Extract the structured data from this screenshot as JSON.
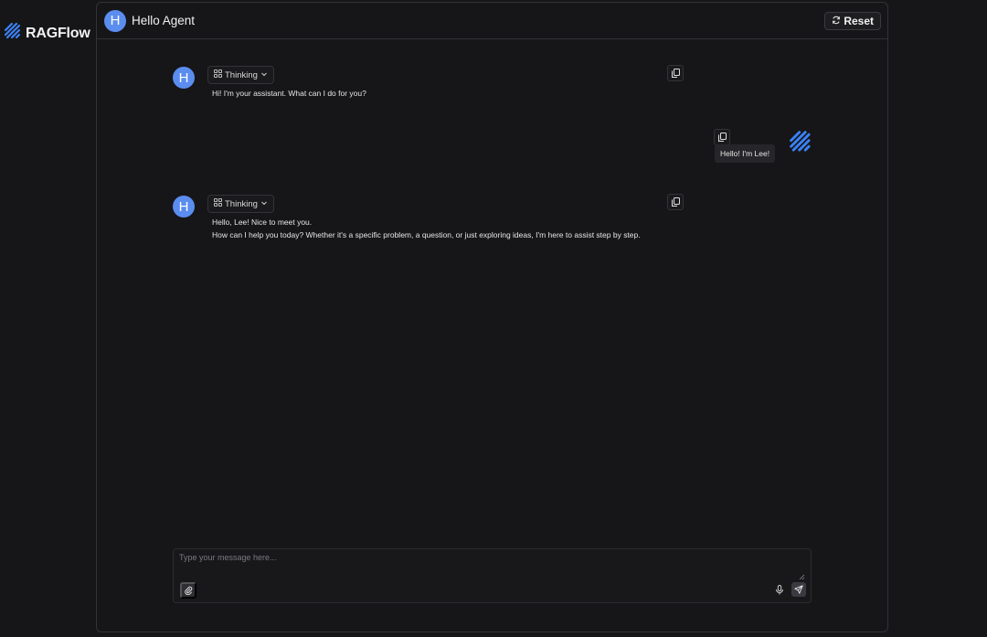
{
  "brand": {
    "name": "RAGFlow",
    "logo_icon": "ragflow-logo-icon"
  },
  "header": {
    "avatar_letter": "H",
    "title": "Hello Agent",
    "reset_label": "Reset",
    "reset_icon": "refresh-icon"
  },
  "messages": [
    {
      "role": "assistant",
      "avatar_letter": "H",
      "thinking_label": "Thinking",
      "lines": [
        "Hi! I'm your assistant. What can I do for you?"
      ]
    },
    {
      "role": "user",
      "text": "Hello! I'm Lee!"
    },
    {
      "role": "assistant",
      "avatar_letter": "H",
      "thinking_label": "Thinking",
      "lines": [
        "Hello, Lee! Nice to meet you.",
        "How can I help you today? Whether it's a specific problem, a question, or just exploring ideas, I'm here to assist step by step."
      ]
    }
  ],
  "composer": {
    "placeholder": "Type your message here...",
    "value": ""
  },
  "colors": {
    "background": "#161618",
    "avatar": "#5b8def",
    "brand_blue": "#3b82f6"
  }
}
